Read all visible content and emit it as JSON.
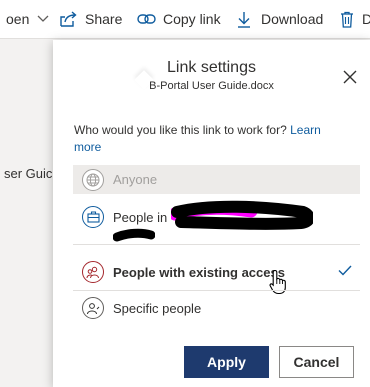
{
  "toolbar": {
    "open_label": "oen",
    "share_label": "Share",
    "copy_link_label": "Copy link",
    "download_label": "Download",
    "delete_label": "D"
  },
  "background": {
    "filename_fragment": "ser Guic"
  },
  "dialog": {
    "title": "Link settings",
    "subtitle": "B-Portal User Guide.docx",
    "question": "Who would you like this link to work for?",
    "learn_more": "Learn more",
    "options": [
      {
        "label": "Anyone",
        "icon": "globe-icon",
        "state": "disabled"
      },
      {
        "label": "People in",
        "icon": "briefcase-icon",
        "state": "enabled"
      },
      {
        "label": "People with existing access",
        "icon": "people-icon",
        "state": "selected"
      },
      {
        "label": "Specific people",
        "icon": "person-icon",
        "state": "enabled"
      }
    ],
    "apply_label": "Apply",
    "cancel_label": "Cancel"
  },
  "colors": {
    "accent": "#1e3a6e",
    "link": "#0f5c9e",
    "existing_icon": "#a4262c",
    "redaction_black": "#000000",
    "redaction_magenta": "#ff00ff"
  }
}
